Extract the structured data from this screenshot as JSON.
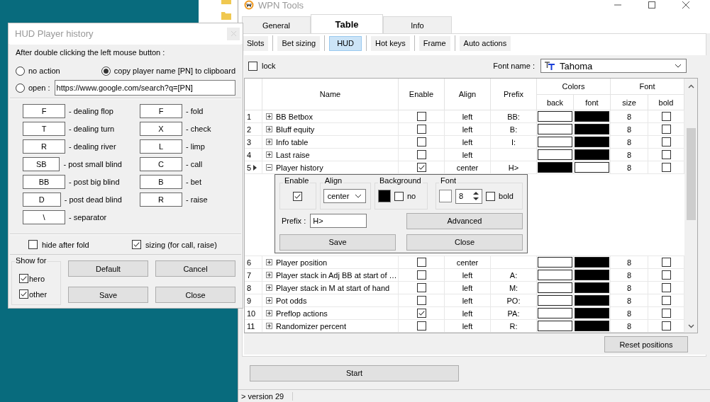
{
  "dialog": {
    "title": "HUD Player history",
    "double_click": {
      "label": "After double clicking the left mouse button :",
      "url": "https://www.google.com/search?q=[PN]",
      "options": [
        {
          "label": "no action",
          "selected": false
        },
        {
          "label": "copy player name [PN] to clipboard",
          "selected": true
        },
        {
          "label": "open :",
          "selected": false
        }
      ]
    },
    "hotkeys_left": [
      {
        "key": "F",
        "action": "- dealing flop"
      },
      {
        "key": "T",
        "action": "- dealing turn"
      },
      {
        "key": "R",
        "action": "- dealing river"
      },
      {
        "key": "SB",
        "action": "- post small blind"
      },
      {
        "key": "BB",
        "action": "- post big blind"
      },
      {
        "key": "D",
        "action": "- post dead blind"
      },
      {
        "key": "\\",
        "action": "- separator"
      }
    ],
    "hotkeys_right": [
      {
        "key": "F",
        "action": "- fold"
      },
      {
        "key": "X",
        "action": "- check"
      },
      {
        "key": "L",
        "action": "- limp"
      },
      {
        "key": "C",
        "action": "- call"
      },
      {
        "key": "B",
        "action": "- bet"
      },
      {
        "key": "R",
        "action": "- raise"
      }
    ],
    "options": [
      {
        "label": "hide after fold",
        "checked": false
      },
      {
        "label": "sizing (for call, raise)",
        "checked": true
      }
    ],
    "show_for": {
      "label": "Show for",
      "items": [
        {
          "label": "hero",
          "checked": true
        },
        {
          "label": "other",
          "checked": true
        }
      ]
    },
    "buttons": [
      "Default",
      "Cancel",
      "Save",
      "Close"
    ]
  },
  "main": {
    "title": "WPN Tools",
    "tabs": [
      {
        "label": "General",
        "selected": false
      },
      {
        "label": "Table",
        "selected": true
      },
      {
        "label": "Info",
        "selected": false
      }
    ],
    "subtabs": [
      {
        "label": "Slots",
        "selected": false
      },
      {
        "label": "Bet sizing",
        "selected": false
      },
      {
        "label": "HUD",
        "selected": true
      },
      {
        "label": "Hot keys",
        "selected": false
      },
      {
        "label": "Frame",
        "selected": false
      },
      {
        "label": "Auto actions",
        "selected": false
      }
    ],
    "lock": {
      "label": "lock",
      "checked": false
    },
    "font_name": {
      "label": "Font name :",
      "value": "Tahoma"
    },
    "table": {
      "columns": {
        "name": "Name",
        "enable": "Enable",
        "align": "Align",
        "prefix": "Prefix",
        "colors": "Colors",
        "back": "back",
        "font_color": "font",
        "font": "Font",
        "size": "size",
        "bold": "bold"
      },
      "rows": [
        {
          "number": "1",
          "name": "BB Betbox",
          "expanded": false,
          "current": false,
          "enable": false,
          "align": "left",
          "prefix": "BB:",
          "back_swatch": {
            "color": "#ffffff"
          },
          "font_swatch": {
            "color": "#000000"
          },
          "size": "8",
          "bold": false
        },
        {
          "number": "2",
          "name": "Bluff equity",
          "expanded": false,
          "current": false,
          "enable": false,
          "align": "left",
          "prefix": "B:",
          "back_swatch": {
            "color": "#ffffff"
          },
          "font_swatch": {
            "color": "#000000"
          },
          "size": "8",
          "bold": false
        },
        {
          "number": "3",
          "name": "Info table",
          "expanded": false,
          "current": false,
          "enable": false,
          "align": "left",
          "prefix": "I:",
          "back_swatch": {
            "color": "#ffffff"
          },
          "font_swatch": {
            "color": "#000000"
          },
          "size": "8",
          "bold": false
        },
        {
          "number": "4",
          "name": "Last raise",
          "expanded": false,
          "current": false,
          "enable": false,
          "align": "left",
          "back_swatch": {
            "color": "#ffffff"
          },
          "font_swatch": {
            "color": "#000000"
          },
          "size": "8",
          "bold": false
        },
        {
          "number": "5",
          "name": "Player history",
          "expanded": true,
          "current": true,
          "enable": true,
          "align": "center",
          "prefix": "H>",
          "back_swatch": {
            "color": "#000000"
          },
          "font_swatch": {
            "color": "#ffffff"
          },
          "size": "8",
          "bold": false,
          "editor": {
            "enable_label": "Enable",
            "enable": true,
            "align_label": "Align",
            "align": "center",
            "background_label": "Background",
            "background": {
              "color": "#000000"
            },
            "no_label": "no",
            "no_background": false,
            "font_label": "Font",
            "font_swatch": {
              "color": "#ffffff"
            },
            "size": "8",
            "bold_label": "bold",
            "bold": false,
            "prefix_label": "Prefix :",
            "prefix": "H>",
            "advanced": "Advanced",
            "save": "Save",
            "close": "Close"
          }
        },
        {
          "number": "6",
          "name": "Player position",
          "expanded": false,
          "current": false,
          "enable": false,
          "align": "center",
          "back_swatch": {
            "color": "#ffffff"
          },
          "font_swatch": {
            "color": "#000000"
          },
          "size": "8",
          "bold": false
        },
        {
          "number": "7",
          "name": "Player stack in Adj BB at start of …",
          "expanded": false,
          "current": false,
          "enable": false,
          "align": "left",
          "prefix": "A:",
          "back_swatch": {
            "color": "#ffffff"
          },
          "font_swatch": {
            "color": "#000000"
          },
          "size": "8",
          "bold": false
        },
        {
          "number": "8",
          "name": "Player stack in M at start of hand",
          "expanded": false,
          "current": false,
          "enable": false,
          "align": "left",
          "prefix": "M:",
          "back_swatch": {
            "color": "#ffffff"
          },
          "font_swatch": {
            "color": "#000000"
          },
          "size": "8",
          "bold": false
        },
        {
          "number": "9",
          "name": "Pot odds",
          "expanded": false,
          "current": false,
          "enable": false,
          "align": "left",
          "prefix": "PO:",
          "back_swatch": {
            "color": "#ffffff"
          },
          "font_swatch": {
            "color": "#000000"
          },
          "size": "8",
          "bold": false
        },
        {
          "number": "10",
          "name": "Preflop actions",
          "expanded": false,
          "current": false,
          "enable": true,
          "align": "left",
          "prefix": "PA:",
          "back_swatch": {
            "color": "#ffffff"
          },
          "font_swatch": {
            "color": "#000000"
          },
          "size": "8",
          "bold": false
        },
        {
          "number": "11",
          "name": "Randomizer percent",
          "expanded": false,
          "current": false,
          "enable": false,
          "align": "left",
          "prefix": "R:",
          "back_swatch": {
            "color": "#ffffff"
          },
          "font_swatch": {
            "color": "#000000"
          },
          "size": "8",
          "bold": false
        }
      ]
    },
    "reset_button": "Reset positions",
    "start_button": "Start",
    "status": "> version 29"
  }
}
